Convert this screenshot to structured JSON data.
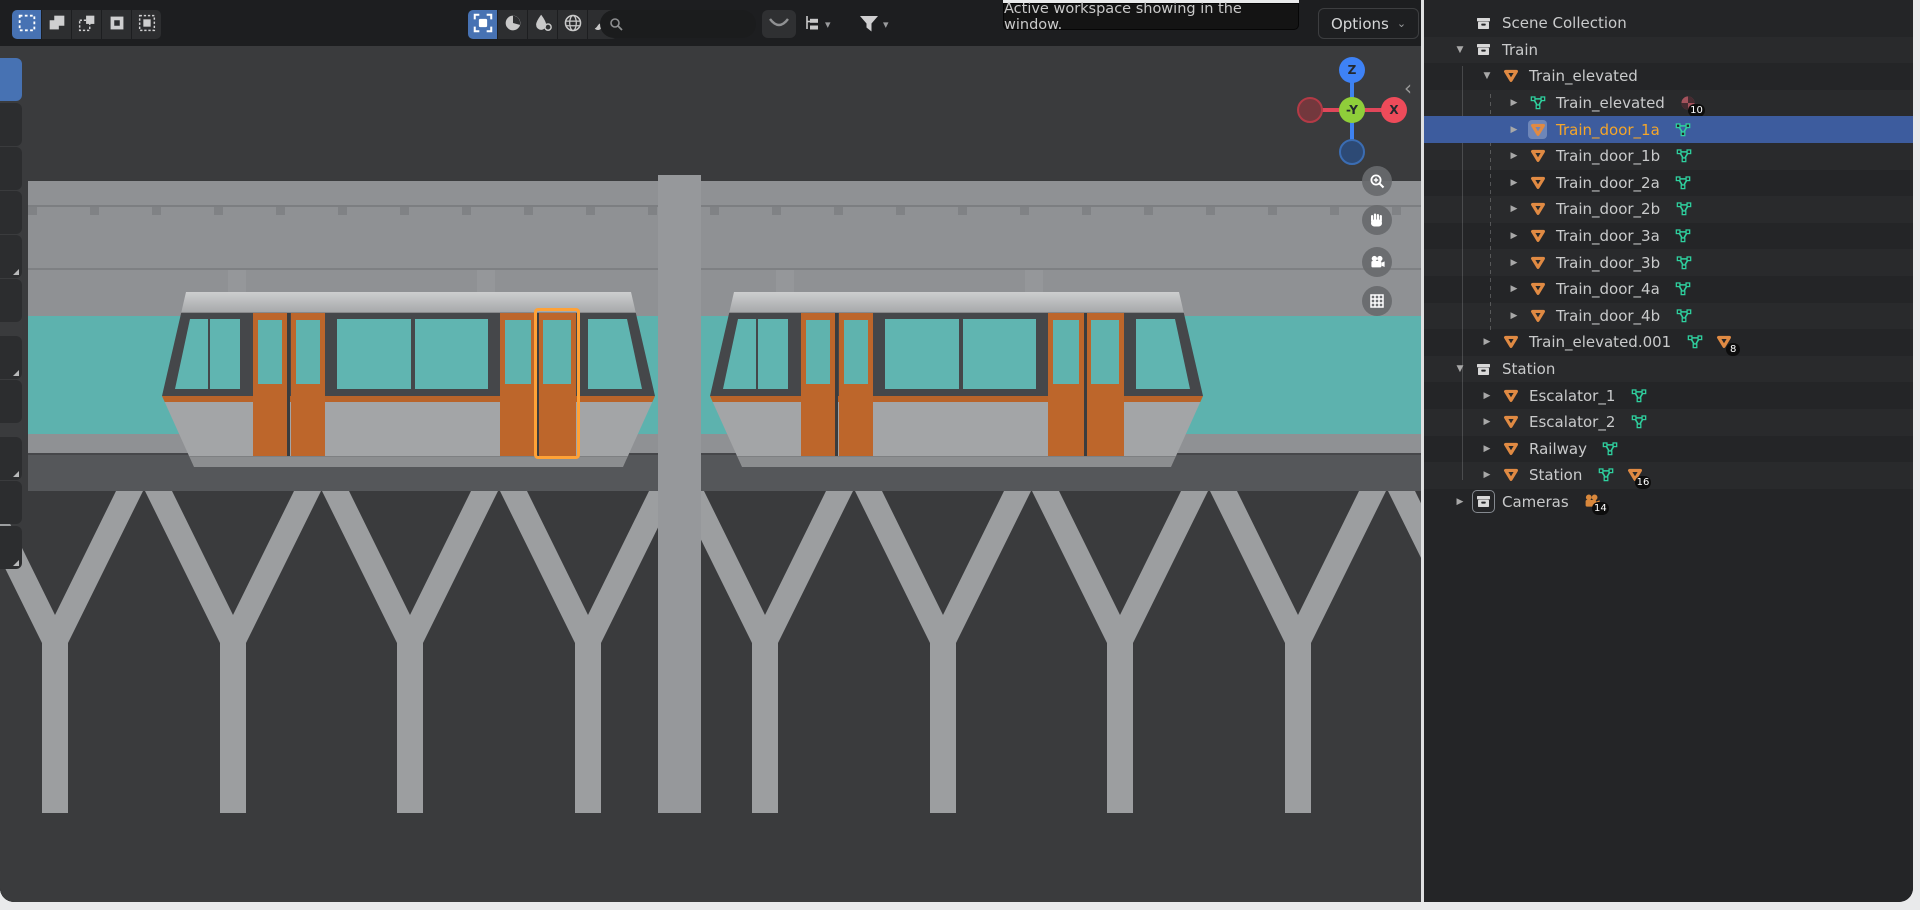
{
  "header": {
    "tooltip": "Active workspace showing in the window.",
    "options_label": "Options",
    "search_placeholder": "",
    "select_mode_icons": [
      "select-set-icon",
      "select-extend-icon",
      "select-subtract-icon",
      "select-invert-icon",
      "select-intersect-icon"
    ],
    "shading_icons": [
      "xray-toggle-icon",
      "shading-solid-icon",
      "shading-material-icon",
      "shading-rendered-icon",
      "annotate-brush-icon"
    ],
    "display_mode_icon": "hierarchy-tree-icon",
    "filter_icon": "funnel-filter-icon"
  },
  "gizmo": {
    "z_label": "Z",
    "x_label": "X",
    "neg_y_label": "-Y"
  },
  "colors": {
    "accent_blue": "#4772b3",
    "selected_row": "#3d5c9e",
    "active_text": "#f5a62a",
    "mesh_object_icon": "#e08a43",
    "mesh_data_icon": "#2fd19f",
    "teal_scene": "#5db2ae",
    "door_orange": "#bd662b",
    "selection_outline": "#ffa237"
  },
  "outliner": {
    "rows": [
      {
        "indent": 0,
        "expander": "none",
        "icon": "collection",
        "label": "Scene Collection",
        "right": []
      },
      {
        "indent": 0,
        "expander": "open",
        "icon": "collection",
        "label": "Train",
        "right": []
      },
      {
        "indent": 1,
        "expander": "open",
        "icon": "mesh_object",
        "label": "Train_elevated",
        "right": []
      },
      {
        "indent": 2,
        "expander": "closed",
        "icon": "mesh_data",
        "label": "Train_elevated",
        "right": [
          {
            "icon": "material",
            "badge": "10"
          }
        ]
      },
      {
        "indent": 2,
        "expander": "closed",
        "icon": "mesh_object",
        "label": "Train_door_1a",
        "selected": true,
        "active": true,
        "icon_boxed": true,
        "right": [
          {
            "icon": "mesh_data"
          }
        ]
      },
      {
        "indent": 2,
        "expander": "closed",
        "icon": "mesh_object",
        "label": "Train_door_1b",
        "right": [
          {
            "icon": "mesh_data"
          }
        ]
      },
      {
        "indent": 2,
        "expander": "closed",
        "icon": "mesh_object",
        "label": "Train_door_2a",
        "right": [
          {
            "icon": "mesh_data"
          }
        ]
      },
      {
        "indent": 2,
        "expander": "closed",
        "icon": "mesh_object",
        "label": "Train_door_2b",
        "right": [
          {
            "icon": "mesh_data"
          }
        ]
      },
      {
        "indent": 2,
        "expander": "closed",
        "icon": "mesh_object",
        "label": "Train_door_3a",
        "right": [
          {
            "icon": "mesh_data"
          }
        ]
      },
      {
        "indent": 2,
        "expander": "closed",
        "icon": "mesh_object",
        "label": "Train_door_3b",
        "right": [
          {
            "icon": "mesh_data"
          }
        ]
      },
      {
        "indent": 2,
        "expander": "closed",
        "icon": "mesh_object",
        "label": "Train_door_4a",
        "right": [
          {
            "icon": "mesh_data"
          }
        ]
      },
      {
        "indent": 2,
        "expander": "closed",
        "icon": "mesh_object",
        "label": "Train_door_4b",
        "right": [
          {
            "icon": "mesh_data"
          }
        ]
      },
      {
        "indent": 1,
        "expander": "closed",
        "icon": "mesh_object",
        "label": "Train_elevated.001",
        "right": [
          {
            "icon": "mesh_data"
          },
          {
            "icon": "mesh_object",
            "badge": "8"
          }
        ]
      },
      {
        "indent": 0,
        "expander": "open",
        "icon": "collection",
        "label": "Station",
        "right": []
      },
      {
        "indent": 1,
        "expander": "closed",
        "icon": "mesh_object",
        "label": "Escalator_1",
        "right": [
          {
            "icon": "mesh_data"
          }
        ]
      },
      {
        "indent": 1,
        "expander": "closed",
        "icon": "mesh_object",
        "label": "Escalator_2",
        "right": [
          {
            "icon": "mesh_data"
          }
        ]
      },
      {
        "indent": 1,
        "expander": "closed",
        "icon": "mesh_object",
        "label": "Railway",
        "right": [
          {
            "icon": "mesh_data"
          }
        ]
      },
      {
        "indent": 1,
        "expander": "closed",
        "icon": "mesh_object",
        "label": "Station",
        "right": [
          {
            "icon": "mesh_data"
          },
          {
            "icon": "mesh_object",
            "badge": "16"
          }
        ]
      },
      {
        "indent": 0,
        "expander": "closed",
        "icon": "collection",
        "label": "Cameras",
        "coll_boxed": true,
        "right": [
          {
            "icon": "camera",
            "badge": "14"
          }
        ]
      }
    ]
  }
}
